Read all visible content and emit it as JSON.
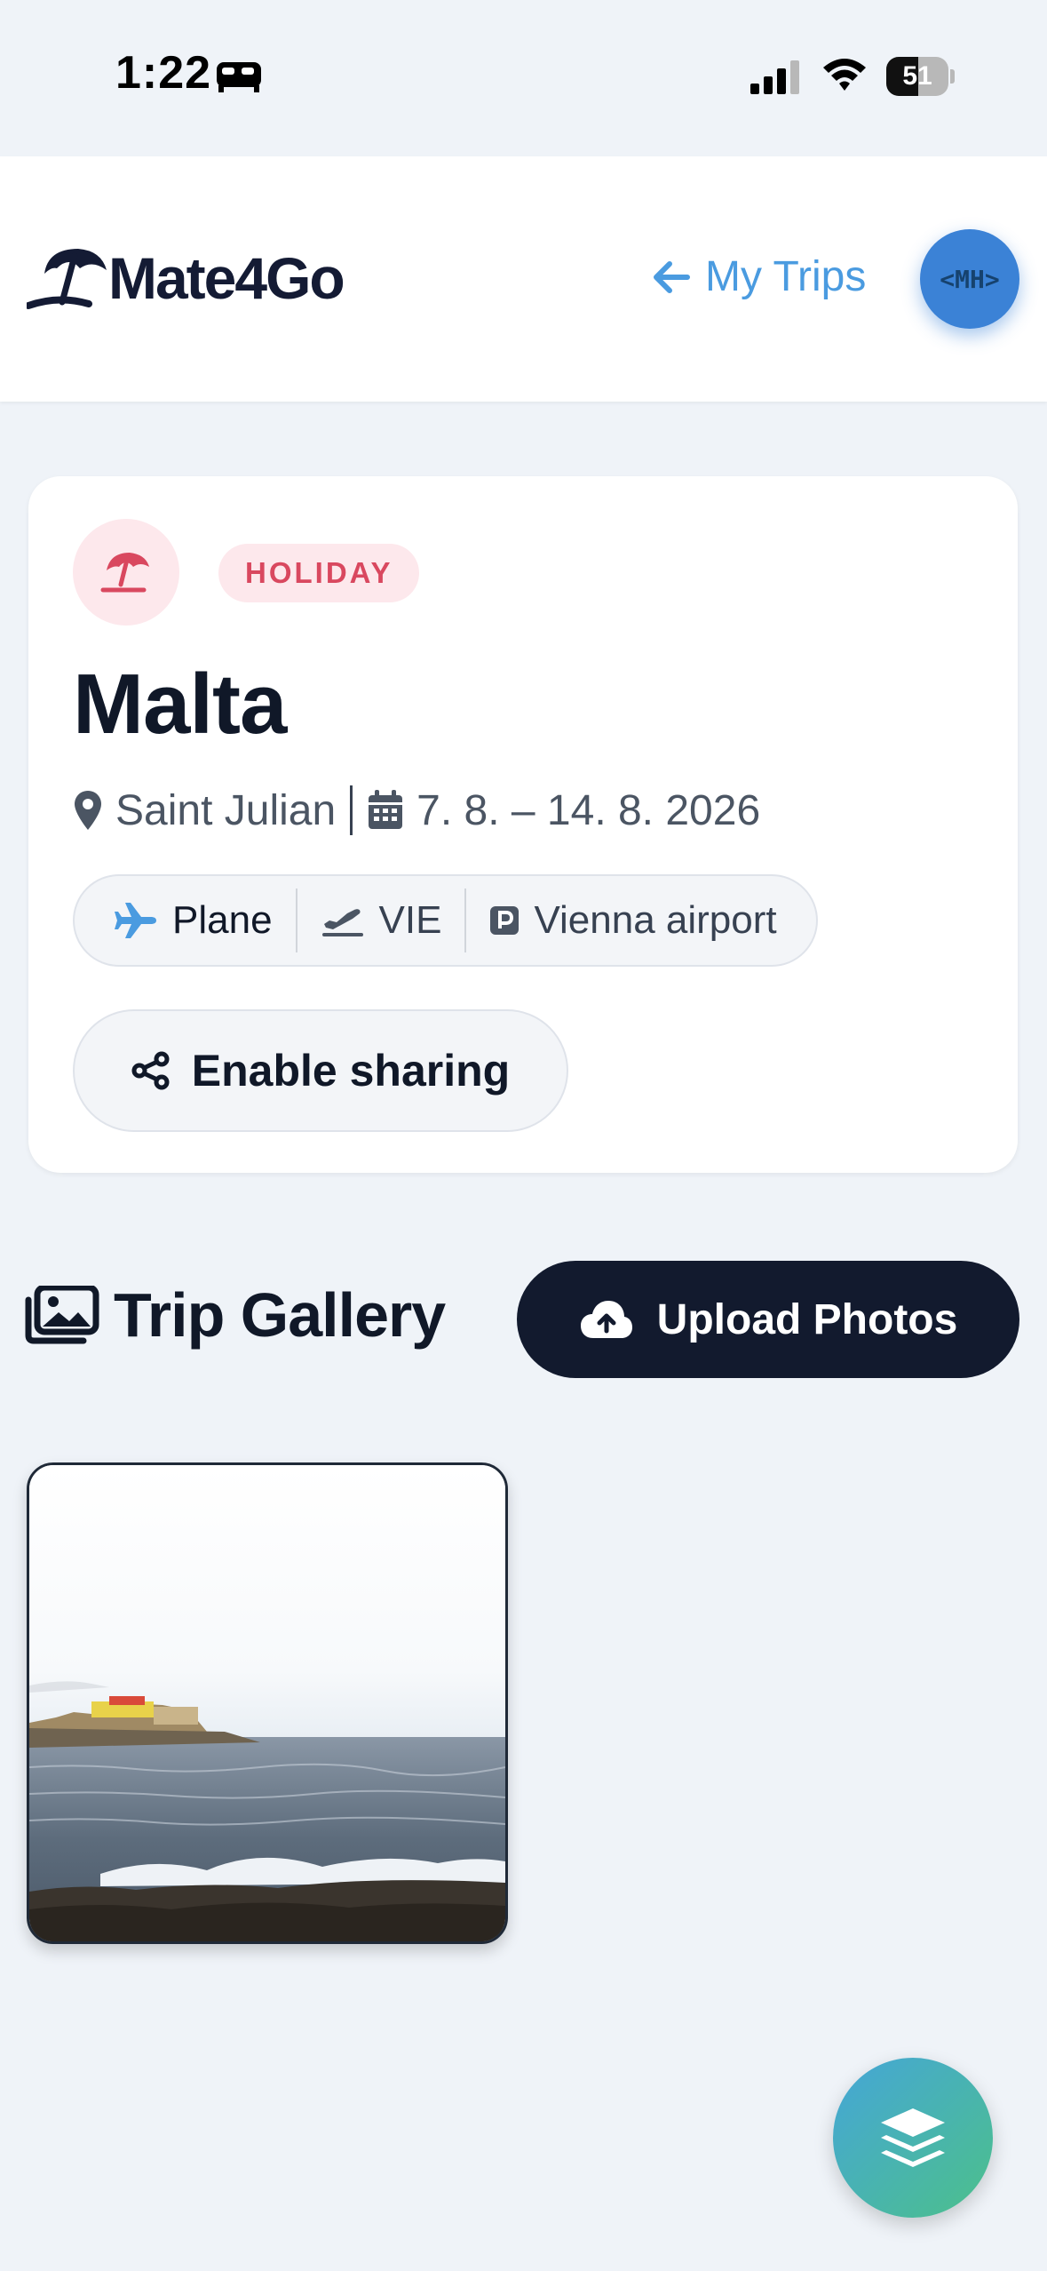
{
  "status_bar": {
    "time": "1:22",
    "battery_percent": "51",
    "battery_level": 0.51,
    "mode_icon": "bed-icon"
  },
  "header": {
    "brand": "Mate4Go",
    "back_label": "My Trips",
    "avatar_initials": "<MH>"
  },
  "trip": {
    "category": "HOLIDAY",
    "title": "Malta",
    "location": "Saint Julian",
    "dates": "7. 8. – 14. 8. 2026",
    "transport": {
      "mode": "Plane",
      "departure_code": "VIE",
      "parking": "Vienna airport"
    },
    "share_label": "Enable sharing"
  },
  "gallery": {
    "title": "Trip Gallery",
    "upload_label": "Upload Photos",
    "photos": [
      {
        "description": "Coastal view of Malta with sea and fortress"
      }
    ]
  },
  "colors": {
    "accent_blue": "#4a9be0",
    "holiday_red": "#d9485f",
    "dark_navy": "#121a2e",
    "background": "#eff3f8"
  }
}
